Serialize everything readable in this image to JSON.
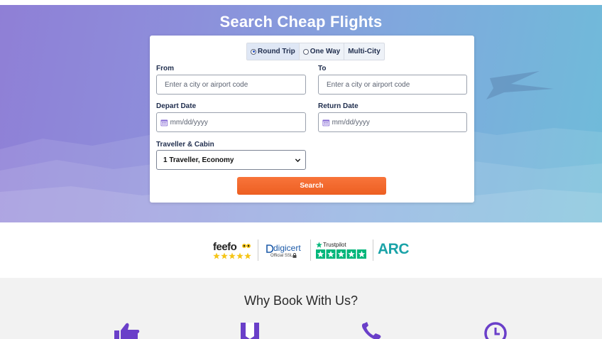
{
  "hero": {
    "title": "Search Cheap Flights"
  },
  "trip_type": {
    "options": [
      {
        "label": "Round Trip",
        "selected": true
      },
      {
        "label": "One Way",
        "selected": false
      },
      {
        "label": "Multi-City",
        "selected": false
      }
    ]
  },
  "form": {
    "from_label": "From",
    "from_placeholder": "Enter a city or airport code",
    "to_label": "To",
    "to_placeholder": "Enter a city or airport code",
    "depart_label": "Depart Date",
    "depart_placeholder": "mm/dd/yyyy",
    "return_label": "Return Date",
    "return_placeholder": "mm/dd/yyyy",
    "traveller_label": "Traveller & Cabin",
    "traveller_value": "1 Traveller, Economy",
    "search_label": "Search"
  },
  "trust": {
    "feefo": "feefo",
    "digicert": "digicert",
    "digicert_sub": "Official SSL",
    "trustpilot": "Trustpilot",
    "arc": "ARC"
  },
  "why": {
    "title": "Why Book With Us?"
  },
  "colors": {
    "accent_orange": "#f36b2e",
    "brand_purple": "#6a3fc9",
    "trustpilot_green": "#00b67a",
    "feefo_yellow": "#f5c518",
    "arc_teal": "#1aa3a8"
  }
}
